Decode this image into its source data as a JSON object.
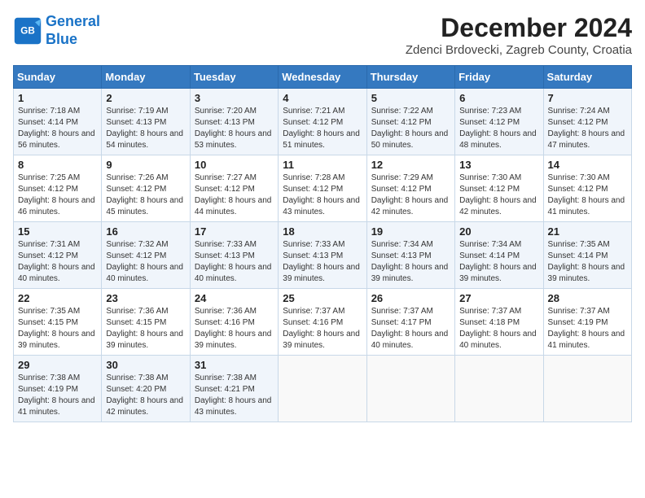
{
  "header": {
    "logo_line1": "General",
    "logo_line2": "Blue",
    "month_title": "December 2024",
    "location": "Zdenci Brdovecki, Zagreb County, Croatia"
  },
  "weekdays": [
    "Sunday",
    "Monday",
    "Tuesday",
    "Wednesday",
    "Thursday",
    "Friday",
    "Saturday"
  ],
  "weeks": [
    [
      {
        "day": "1",
        "sunrise": "Sunrise: 7:18 AM",
        "sunset": "Sunset: 4:14 PM",
        "daylight": "Daylight: 8 hours and 56 minutes."
      },
      {
        "day": "2",
        "sunrise": "Sunrise: 7:19 AM",
        "sunset": "Sunset: 4:13 PM",
        "daylight": "Daylight: 8 hours and 54 minutes."
      },
      {
        "day": "3",
        "sunrise": "Sunrise: 7:20 AM",
        "sunset": "Sunset: 4:13 PM",
        "daylight": "Daylight: 8 hours and 53 minutes."
      },
      {
        "day": "4",
        "sunrise": "Sunrise: 7:21 AM",
        "sunset": "Sunset: 4:12 PM",
        "daylight": "Daylight: 8 hours and 51 minutes."
      },
      {
        "day": "5",
        "sunrise": "Sunrise: 7:22 AM",
        "sunset": "Sunset: 4:12 PM",
        "daylight": "Daylight: 8 hours and 50 minutes."
      },
      {
        "day": "6",
        "sunrise": "Sunrise: 7:23 AM",
        "sunset": "Sunset: 4:12 PM",
        "daylight": "Daylight: 8 hours and 48 minutes."
      },
      {
        "day": "7",
        "sunrise": "Sunrise: 7:24 AM",
        "sunset": "Sunset: 4:12 PM",
        "daylight": "Daylight: 8 hours and 47 minutes."
      }
    ],
    [
      {
        "day": "8",
        "sunrise": "Sunrise: 7:25 AM",
        "sunset": "Sunset: 4:12 PM",
        "daylight": "Daylight: 8 hours and 46 minutes."
      },
      {
        "day": "9",
        "sunrise": "Sunrise: 7:26 AM",
        "sunset": "Sunset: 4:12 PM",
        "daylight": "Daylight: 8 hours and 45 minutes."
      },
      {
        "day": "10",
        "sunrise": "Sunrise: 7:27 AM",
        "sunset": "Sunset: 4:12 PM",
        "daylight": "Daylight: 8 hours and 44 minutes."
      },
      {
        "day": "11",
        "sunrise": "Sunrise: 7:28 AM",
        "sunset": "Sunset: 4:12 PM",
        "daylight": "Daylight: 8 hours and 43 minutes."
      },
      {
        "day": "12",
        "sunrise": "Sunrise: 7:29 AM",
        "sunset": "Sunset: 4:12 PM",
        "daylight": "Daylight: 8 hours and 42 minutes."
      },
      {
        "day": "13",
        "sunrise": "Sunrise: 7:30 AM",
        "sunset": "Sunset: 4:12 PM",
        "daylight": "Daylight: 8 hours and 42 minutes."
      },
      {
        "day": "14",
        "sunrise": "Sunrise: 7:30 AM",
        "sunset": "Sunset: 4:12 PM",
        "daylight": "Daylight: 8 hours and 41 minutes."
      }
    ],
    [
      {
        "day": "15",
        "sunrise": "Sunrise: 7:31 AM",
        "sunset": "Sunset: 4:12 PM",
        "daylight": "Daylight: 8 hours and 40 minutes."
      },
      {
        "day": "16",
        "sunrise": "Sunrise: 7:32 AM",
        "sunset": "Sunset: 4:12 PM",
        "daylight": "Daylight: 8 hours and 40 minutes."
      },
      {
        "day": "17",
        "sunrise": "Sunrise: 7:33 AM",
        "sunset": "Sunset: 4:13 PM",
        "daylight": "Daylight: 8 hours and 40 minutes."
      },
      {
        "day": "18",
        "sunrise": "Sunrise: 7:33 AM",
        "sunset": "Sunset: 4:13 PM",
        "daylight": "Daylight: 8 hours and 39 minutes."
      },
      {
        "day": "19",
        "sunrise": "Sunrise: 7:34 AM",
        "sunset": "Sunset: 4:13 PM",
        "daylight": "Daylight: 8 hours and 39 minutes."
      },
      {
        "day": "20",
        "sunrise": "Sunrise: 7:34 AM",
        "sunset": "Sunset: 4:14 PM",
        "daylight": "Daylight: 8 hours and 39 minutes."
      },
      {
        "day": "21",
        "sunrise": "Sunrise: 7:35 AM",
        "sunset": "Sunset: 4:14 PM",
        "daylight": "Daylight: 8 hours and 39 minutes."
      }
    ],
    [
      {
        "day": "22",
        "sunrise": "Sunrise: 7:35 AM",
        "sunset": "Sunset: 4:15 PM",
        "daylight": "Daylight: 8 hours and 39 minutes."
      },
      {
        "day": "23",
        "sunrise": "Sunrise: 7:36 AM",
        "sunset": "Sunset: 4:15 PM",
        "daylight": "Daylight: 8 hours and 39 minutes."
      },
      {
        "day": "24",
        "sunrise": "Sunrise: 7:36 AM",
        "sunset": "Sunset: 4:16 PM",
        "daylight": "Daylight: 8 hours and 39 minutes."
      },
      {
        "day": "25",
        "sunrise": "Sunrise: 7:37 AM",
        "sunset": "Sunset: 4:16 PM",
        "daylight": "Daylight: 8 hours and 39 minutes."
      },
      {
        "day": "26",
        "sunrise": "Sunrise: 7:37 AM",
        "sunset": "Sunset: 4:17 PM",
        "daylight": "Daylight: 8 hours and 40 minutes."
      },
      {
        "day": "27",
        "sunrise": "Sunrise: 7:37 AM",
        "sunset": "Sunset: 4:18 PM",
        "daylight": "Daylight: 8 hours and 40 minutes."
      },
      {
        "day": "28",
        "sunrise": "Sunrise: 7:37 AM",
        "sunset": "Sunset: 4:19 PM",
        "daylight": "Daylight: 8 hours and 41 minutes."
      }
    ],
    [
      {
        "day": "29",
        "sunrise": "Sunrise: 7:38 AM",
        "sunset": "Sunset: 4:19 PM",
        "daylight": "Daylight: 8 hours and 41 minutes."
      },
      {
        "day": "30",
        "sunrise": "Sunrise: 7:38 AM",
        "sunset": "Sunset: 4:20 PM",
        "daylight": "Daylight: 8 hours and 42 minutes."
      },
      {
        "day": "31",
        "sunrise": "Sunrise: 7:38 AM",
        "sunset": "Sunset: 4:21 PM",
        "daylight": "Daylight: 8 hours and 43 minutes."
      },
      null,
      null,
      null,
      null
    ]
  ]
}
